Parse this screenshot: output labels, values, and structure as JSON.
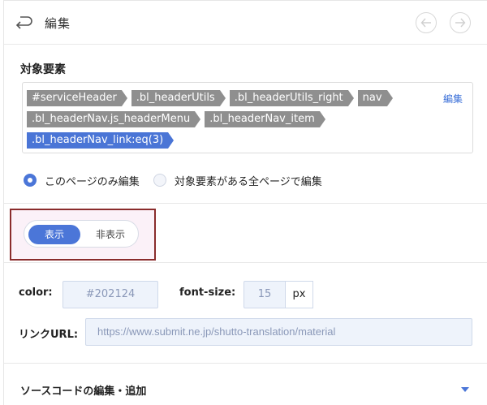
{
  "header": {
    "title": "編集",
    "back_icon": "return-arrow-icon",
    "prev_icon": "arrow-left-icon",
    "next_icon": "arrow-right-icon"
  },
  "target": {
    "section_title": "対象要素",
    "edit_label": "編集",
    "breadcrumb_lines": [
      [
        "#serviceHeader",
        ".bl_headerUtils",
        ".bl_headerUtils_right",
        "nav"
      ],
      [
        ".bl_headerNav.js_headerMenu",
        ".bl_headerNav_item"
      ],
      [
        ".bl_headerNav_link:eq(3)"
      ]
    ],
    "active_selector": ".bl_headerNav_link:eq(3)"
  },
  "scope": {
    "options": [
      "このページのみ編集",
      "対象要素がある全ページで編集"
    ],
    "selected": "このページのみ編集"
  },
  "visibility": {
    "on_label": "表示",
    "off_label": "非表示",
    "selected": "表示"
  },
  "props": {
    "color_label": "color:",
    "color_value": "#202124",
    "font_size_label": "font-size:",
    "font_size_value": "15",
    "font_size_unit": "px",
    "link_label": "リンクURL:",
    "link_value": "https://www.submit.ne.jp/shutto-translation/material"
  },
  "source": {
    "title": "ソースコードの編集・追加"
  },
  "colors": {
    "accent": "#4b76d8",
    "crumb": "#8f8f8f",
    "highlight_border": "#8a2c2c"
  }
}
